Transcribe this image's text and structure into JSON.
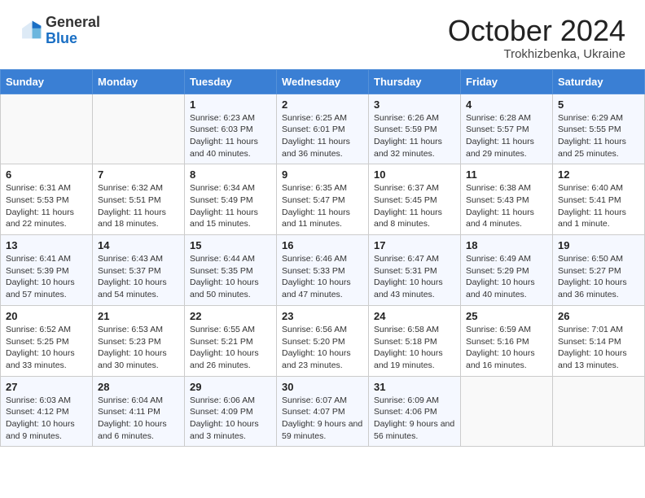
{
  "header": {
    "logo_general": "General",
    "logo_blue": "Blue",
    "month_title": "October 2024",
    "subtitle": "Trokhizbenka, Ukraine"
  },
  "weekdays": [
    "Sunday",
    "Monday",
    "Tuesday",
    "Wednesday",
    "Thursday",
    "Friday",
    "Saturday"
  ],
  "weeks": [
    [
      {
        "day": "",
        "sunrise": "",
        "sunset": "",
        "daylight": ""
      },
      {
        "day": "",
        "sunrise": "",
        "sunset": "",
        "daylight": ""
      },
      {
        "day": "1",
        "sunrise": "Sunrise: 6:23 AM",
        "sunset": "Sunset: 6:03 PM",
        "daylight": "Daylight: 11 hours and 40 minutes."
      },
      {
        "day": "2",
        "sunrise": "Sunrise: 6:25 AM",
        "sunset": "Sunset: 6:01 PM",
        "daylight": "Daylight: 11 hours and 36 minutes."
      },
      {
        "day": "3",
        "sunrise": "Sunrise: 6:26 AM",
        "sunset": "Sunset: 5:59 PM",
        "daylight": "Daylight: 11 hours and 32 minutes."
      },
      {
        "day": "4",
        "sunrise": "Sunrise: 6:28 AM",
        "sunset": "Sunset: 5:57 PM",
        "daylight": "Daylight: 11 hours and 29 minutes."
      },
      {
        "day": "5",
        "sunrise": "Sunrise: 6:29 AM",
        "sunset": "Sunset: 5:55 PM",
        "daylight": "Daylight: 11 hours and 25 minutes."
      }
    ],
    [
      {
        "day": "6",
        "sunrise": "Sunrise: 6:31 AM",
        "sunset": "Sunset: 5:53 PM",
        "daylight": "Daylight: 11 hours and 22 minutes."
      },
      {
        "day": "7",
        "sunrise": "Sunrise: 6:32 AM",
        "sunset": "Sunset: 5:51 PM",
        "daylight": "Daylight: 11 hours and 18 minutes."
      },
      {
        "day": "8",
        "sunrise": "Sunrise: 6:34 AM",
        "sunset": "Sunset: 5:49 PM",
        "daylight": "Daylight: 11 hours and 15 minutes."
      },
      {
        "day": "9",
        "sunrise": "Sunrise: 6:35 AM",
        "sunset": "Sunset: 5:47 PM",
        "daylight": "Daylight: 11 hours and 11 minutes."
      },
      {
        "day": "10",
        "sunrise": "Sunrise: 6:37 AM",
        "sunset": "Sunset: 5:45 PM",
        "daylight": "Daylight: 11 hours and 8 minutes."
      },
      {
        "day": "11",
        "sunrise": "Sunrise: 6:38 AM",
        "sunset": "Sunset: 5:43 PM",
        "daylight": "Daylight: 11 hours and 4 minutes."
      },
      {
        "day": "12",
        "sunrise": "Sunrise: 6:40 AM",
        "sunset": "Sunset: 5:41 PM",
        "daylight": "Daylight: 11 hours and 1 minute."
      }
    ],
    [
      {
        "day": "13",
        "sunrise": "Sunrise: 6:41 AM",
        "sunset": "Sunset: 5:39 PM",
        "daylight": "Daylight: 10 hours and 57 minutes."
      },
      {
        "day": "14",
        "sunrise": "Sunrise: 6:43 AM",
        "sunset": "Sunset: 5:37 PM",
        "daylight": "Daylight: 10 hours and 54 minutes."
      },
      {
        "day": "15",
        "sunrise": "Sunrise: 6:44 AM",
        "sunset": "Sunset: 5:35 PM",
        "daylight": "Daylight: 10 hours and 50 minutes."
      },
      {
        "day": "16",
        "sunrise": "Sunrise: 6:46 AM",
        "sunset": "Sunset: 5:33 PM",
        "daylight": "Daylight: 10 hours and 47 minutes."
      },
      {
        "day": "17",
        "sunrise": "Sunrise: 6:47 AM",
        "sunset": "Sunset: 5:31 PM",
        "daylight": "Daylight: 10 hours and 43 minutes."
      },
      {
        "day": "18",
        "sunrise": "Sunrise: 6:49 AM",
        "sunset": "Sunset: 5:29 PM",
        "daylight": "Daylight: 10 hours and 40 minutes."
      },
      {
        "day": "19",
        "sunrise": "Sunrise: 6:50 AM",
        "sunset": "Sunset: 5:27 PM",
        "daylight": "Daylight: 10 hours and 36 minutes."
      }
    ],
    [
      {
        "day": "20",
        "sunrise": "Sunrise: 6:52 AM",
        "sunset": "Sunset: 5:25 PM",
        "daylight": "Daylight: 10 hours and 33 minutes."
      },
      {
        "day": "21",
        "sunrise": "Sunrise: 6:53 AM",
        "sunset": "Sunset: 5:23 PM",
        "daylight": "Daylight: 10 hours and 30 minutes."
      },
      {
        "day": "22",
        "sunrise": "Sunrise: 6:55 AM",
        "sunset": "Sunset: 5:21 PM",
        "daylight": "Daylight: 10 hours and 26 minutes."
      },
      {
        "day": "23",
        "sunrise": "Sunrise: 6:56 AM",
        "sunset": "Sunset: 5:20 PM",
        "daylight": "Daylight: 10 hours and 23 minutes."
      },
      {
        "day": "24",
        "sunrise": "Sunrise: 6:58 AM",
        "sunset": "Sunset: 5:18 PM",
        "daylight": "Daylight: 10 hours and 19 minutes."
      },
      {
        "day": "25",
        "sunrise": "Sunrise: 6:59 AM",
        "sunset": "Sunset: 5:16 PM",
        "daylight": "Daylight: 10 hours and 16 minutes."
      },
      {
        "day": "26",
        "sunrise": "Sunrise: 7:01 AM",
        "sunset": "Sunset: 5:14 PM",
        "daylight": "Daylight: 10 hours and 13 minutes."
      }
    ],
    [
      {
        "day": "27",
        "sunrise": "Sunrise: 6:03 AM",
        "sunset": "Sunset: 4:12 PM",
        "daylight": "Daylight: 10 hours and 9 minutes."
      },
      {
        "day": "28",
        "sunrise": "Sunrise: 6:04 AM",
        "sunset": "Sunset: 4:11 PM",
        "daylight": "Daylight: 10 hours and 6 minutes."
      },
      {
        "day": "29",
        "sunrise": "Sunrise: 6:06 AM",
        "sunset": "Sunset: 4:09 PM",
        "daylight": "Daylight: 10 hours and 3 minutes."
      },
      {
        "day": "30",
        "sunrise": "Sunrise: 6:07 AM",
        "sunset": "Sunset: 4:07 PM",
        "daylight": "Daylight: 9 hours and 59 minutes."
      },
      {
        "day": "31",
        "sunrise": "Sunrise: 6:09 AM",
        "sunset": "Sunset: 4:06 PM",
        "daylight": "Daylight: 9 hours and 56 minutes."
      },
      {
        "day": "",
        "sunrise": "",
        "sunset": "",
        "daylight": ""
      },
      {
        "day": "",
        "sunrise": "",
        "sunset": "",
        "daylight": ""
      }
    ]
  ]
}
